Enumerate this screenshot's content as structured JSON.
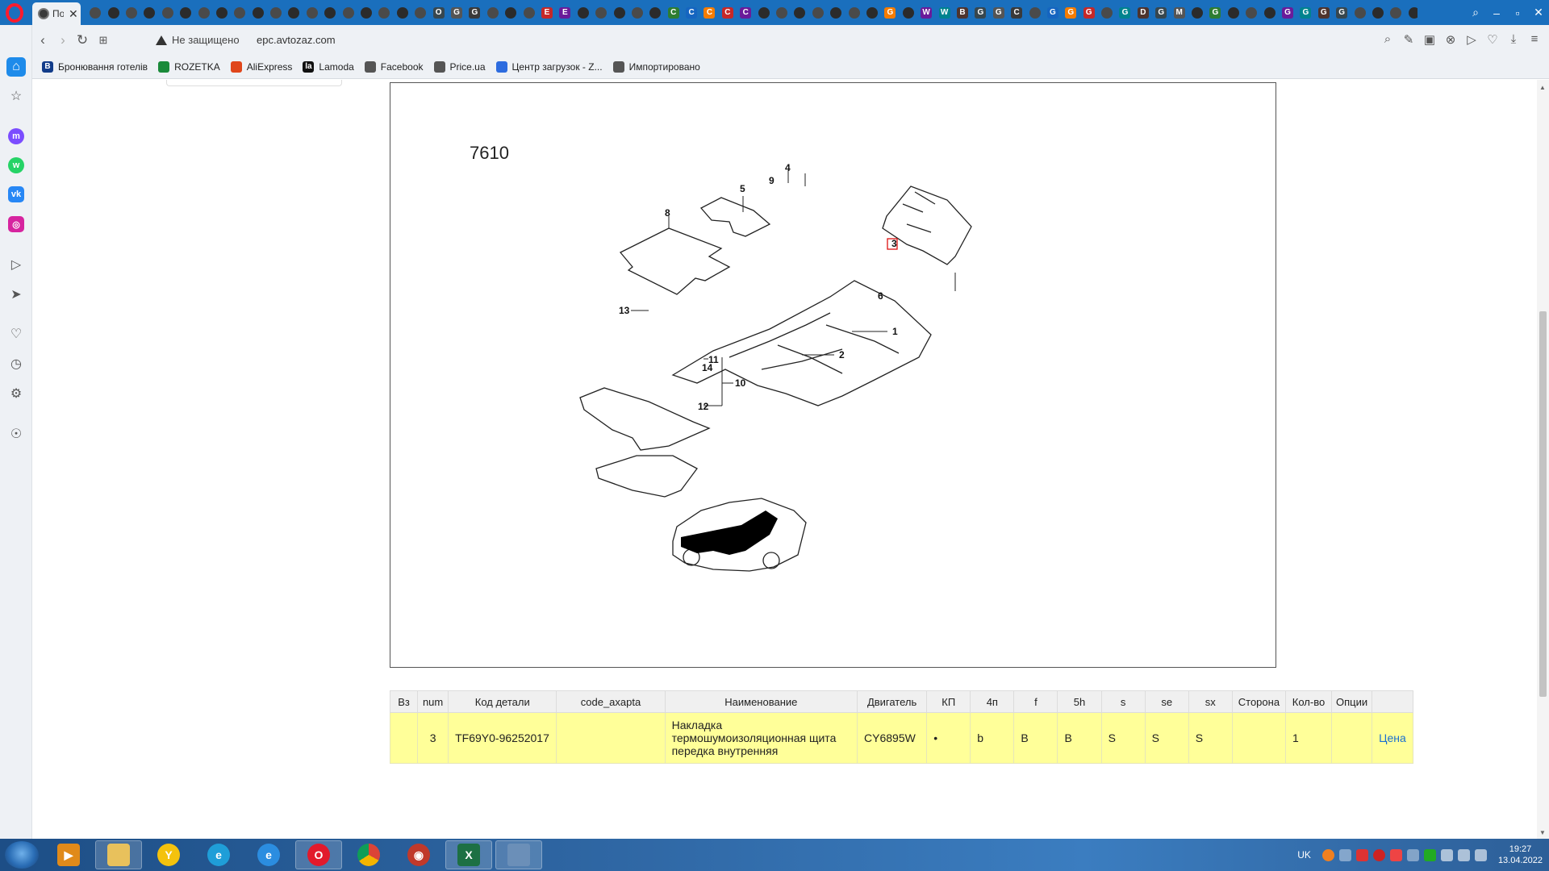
{
  "browser": {
    "active_tab": {
      "title": "По",
      "close": "✕"
    },
    "tab_icon_glyphs": [
      "",
      "",
      "",
      "",
      "",
      "",
      "",
      "",
      "",
      "",
      "",
      "",
      "",
      "",
      "",
      "",
      "",
      "",
      "",
      "O",
      "G",
      "G",
      "",
      "",
      "",
      "E",
      "E",
      "",
      "",
      "",
      "",
      "",
      "C",
      "C",
      "C",
      "C",
      "C",
      "",
      "",
      "",
      "",
      "",
      "",
      "",
      "G",
      "",
      "W",
      "W",
      "B",
      "G",
      "G",
      "C",
      "",
      "G",
      "G",
      "G",
      "",
      "G",
      "D",
      "G",
      "M",
      "",
      "G",
      "",
      "",
      "",
      "G",
      "G",
      "G",
      "G",
      "",
      "",
      "",
      "",
      "O",
      "",
      "",
      "G"
    ],
    "security_label": "Не защищено",
    "url": "epc.avtozaz.com",
    "bookmarks": [
      {
        "label": "Бронювання готелів",
        "icon": "B",
        "color": "#123c8a"
      },
      {
        "label": "ROZETKA",
        "icon": "",
        "color": "#1a8a3a"
      },
      {
        "label": "AliExpress",
        "icon": "",
        "color": "#e0461b"
      },
      {
        "label": "Lamoda",
        "icon": "la",
        "color": "#111111"
      },
      {
        "label": "Facebook",
        "icon": "",
        "color": "#555555"
      },
      {
        "label": "Price.ua",
        "icon": "",
        "color": "#555555"
      },
      {
        "label": "Центр загрузок - Z...",
        "icon": "",
        "color": "#2d6cdf"
      },
      {
        "label": "Импортировано",
        "icon": "",
        "color": "#555555"
      }
    ]
  },
  "diagram": {
    "code": "7610",
    "callouts": [
      "1",
      "2",
      "3",
      "4",
      "5",
      "6",
      "8",
      "9",
      "10",
      "11",
      "12",
      "13",
      "14"
    ]
  },
  "parts_table": {
    "columns": [
      "Вз",
      "num",
      "Код детали",
      "code_axapta",
      "Наименование",
      "Двигатель",
      "КП",
      "4п",
      "f",
      "5h",
      "s",
      "se",
      "sx",
      "Сторона",
      "Кол-во",
      "Опции",
      ""
    ],
    "rows": [
      {
        "vz": "",
        "num": "3",
        "code": "TF69Y0-96252017",
        "code_axapta": "",
        "name": "Накладка термошумоизоляционная щита передка внутренняя",
        "engine": "CY6895W",
        "kp": "•",
        "c4p": "b",
        "f": "B",
        "c5h": "B",
        "s": "S",
        "se": "S",
        "sx": "S",
        "side": "",
        "qty": "1",
        "options": "",
        "price_link": "Цена"
      }
    ]
  },
  "taskbar": {
    "lang": "UK",
    "time": "19:27",
    "date": "13.04.2022"
  },
  "colors": {
    "tabbar": "#1a6fbd",
    "chrome": "#eef1f5",
    "row_highlight": "#ffff99",
    "link": "#1a6fd0"
  }
}
